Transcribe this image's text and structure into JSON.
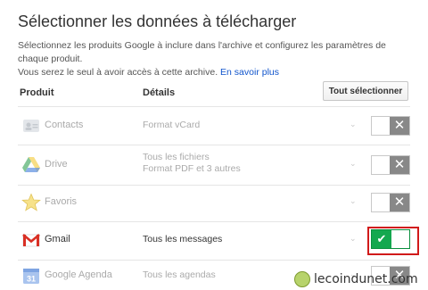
{
  "page": {
    "title": "Sélectionner les données à télécharger",
    "desc_line1": "Sélectionnez les produits Google à inclure dans l'archive et configurez les paramètres de chaque produit.",
    "desc_line2": "Vous serez le seul à avoir accès à cette archive.",
    "learn_more": "En savoir plus"
  },
  "table": {
    "col_product": "Produit",
    "col_details": "Détails",
    "select_all": "Tout sélectionner"
  },
  "products": [
    {
      "name": "Contacts",
      "details_1": "Format vCard",
      "details_2": "",
      "enabled": false,
      "icon": "contacts-icon"
    },
    {
      "name": "Drive",
      "details_1": "Tous les fichiers",
      "details_2": "Format PDF et 3 autres",
      "enabled": false,
      "icon": "drive-icon"
    },
    {
      "name": "Favoris",
      "details_1": "",
      "details_2": "",
      "enabled": false,
      "icon": "star-icon"
    },
    {
      "name": "Gmail",
      "details_1": "Tous les messages",
      "details_2": "",
      "enabled": true,
      "icon": "gmail-icon"
    },
    {
      "name": "Google Agenda",
      "details_1": "Tous les agendas",
      "details_2": "",
      "enabled": false,
      "icon": "calendar-icon"
    }
  ],
  "watermark": "lecoindunet.com",
  "colors": {
    "link": "#1155cc",
    "toggle_on": "#14a84f",
    "toggle_off": "#888888",
    "highlight": "#d11a1a"
  }
}
